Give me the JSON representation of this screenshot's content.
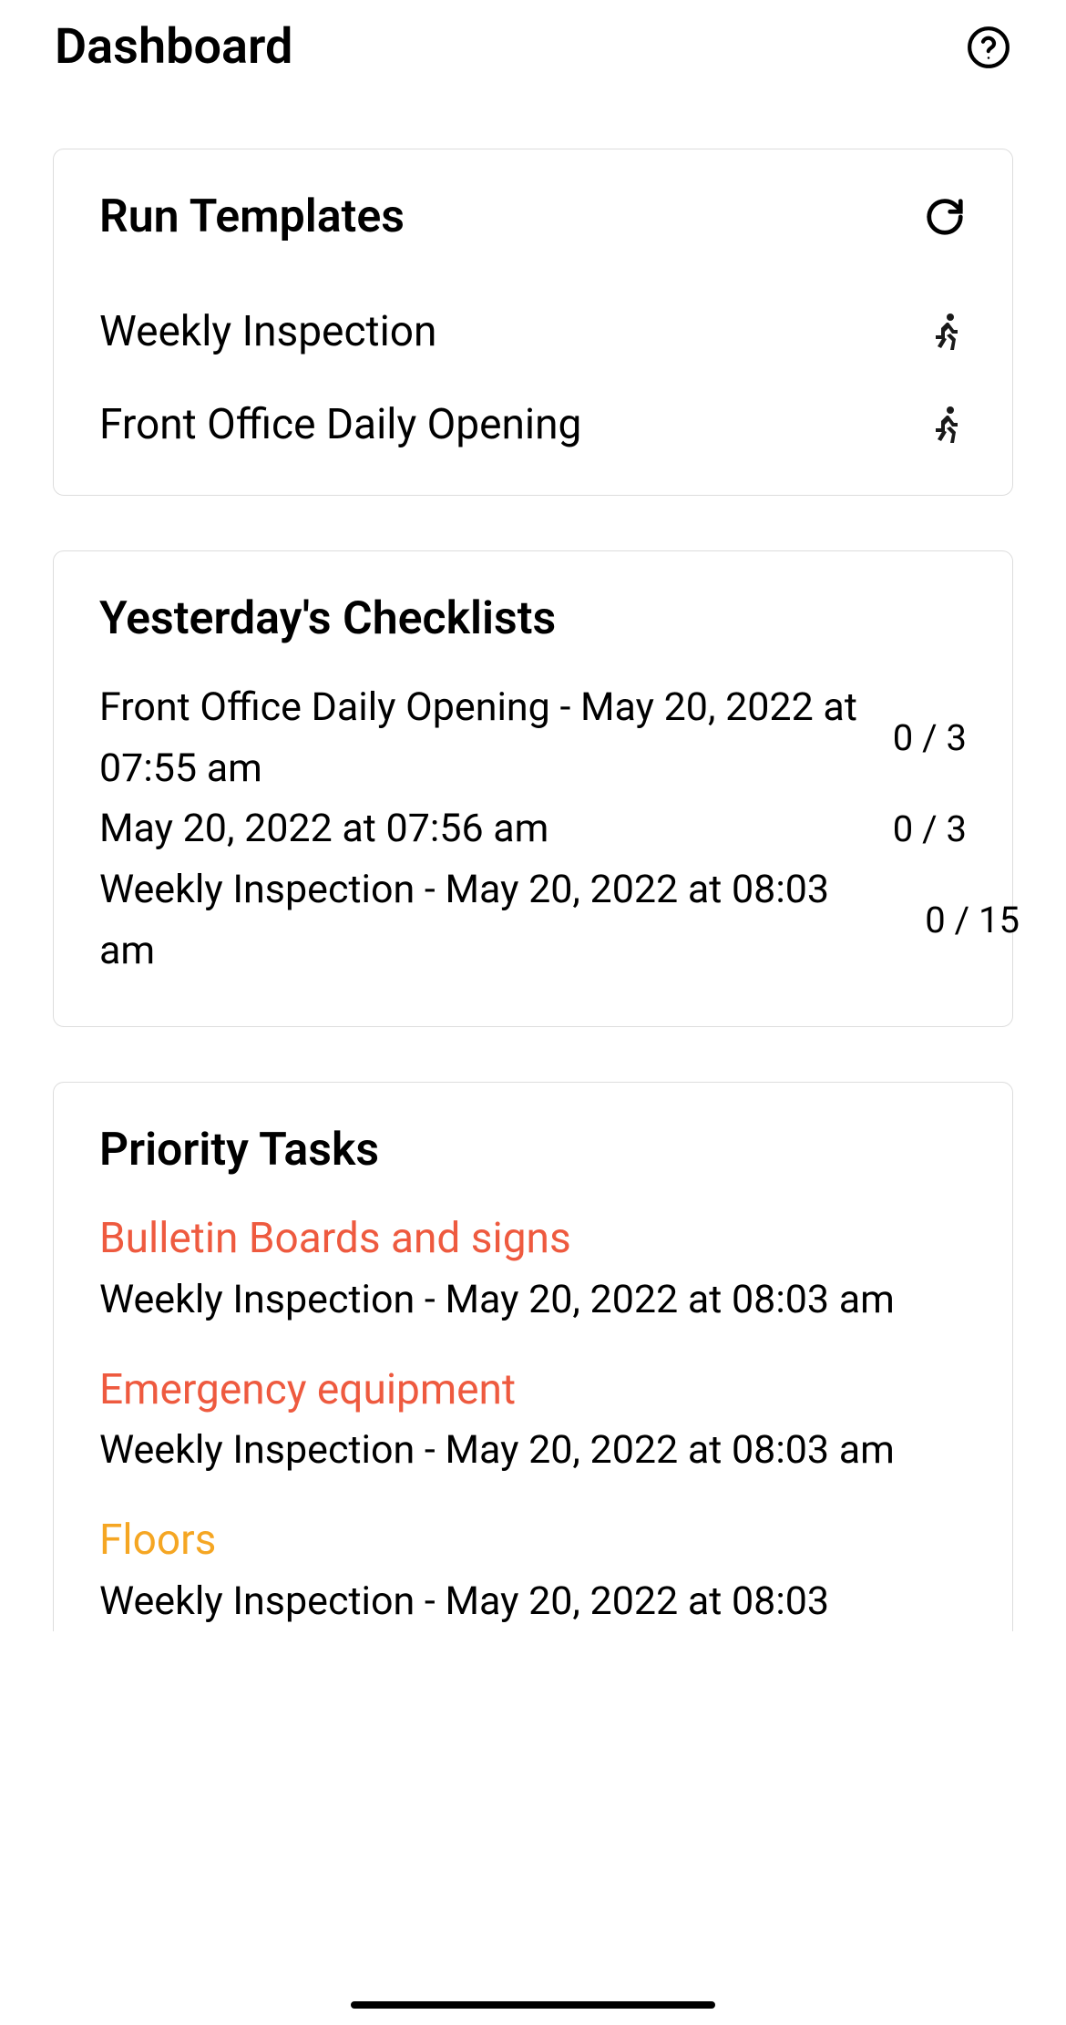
{
  "header": {
    "title": "Dashboard"
  },
  "run_templates": {
    "title": "Run Templates",
    "items": [
      {
        "label": "Weekly Inspection"
      },
      {
        "label": "Front Office Daily Opening"
      }
    ]
  },
  "yesterday_checklists": {
    "title": "Yesterday's Checklists",
    "items": [
      {
        "label": "Front Office Daily Opening  - May 20, 2022 at 07:55 am",
        "count": "0 / 3"
      },
      {
        "label": "May 20, 2022 at 07:56 am",
        "count": "0 / 3"
      },
      {
        "label": "Weekly Inspection - May 20, 2022 at 08:03 am",
        "count": "0 / 15"
      }
    ]
  },
  "priority_tasks": {
    "title": "Priority Tasks",
    "items": [
      {
        "name": "Bulletin Boards and signs",
        "color": "red",
        "sub": "Weekly Inspection - May 20, 2022 at 08:03 am"
      },
      {
        "name": "Emergency equipment",
        "color": "red",
        "sub": "Weekly Inspection - May 20, 2022 at 08:03 am"
      },
      {
        "name": "Floors",
        "color": "orange",
        "sub": "Weekly Inspection - May 20, 2022 at 08:03"
      }
    ]
  }
}
